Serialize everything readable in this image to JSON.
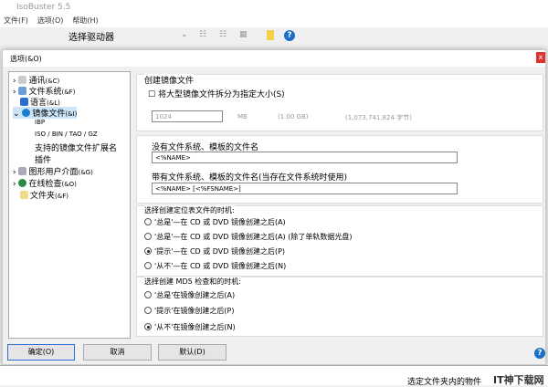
{
  "app": {
    "title": "IsoBuster 5.5",
    "menu": [
      "文件(F)",
      "选项(O)",
      "帮助(H)"
    ],
    "drive_select": "选择驱动器",
    "status": "选定文件夹内的物件",
    "watermark": "IT神下载网"
  },
  "dialog": {
    "title": "选项(&O)",
    "close": "x",
    "tree": [
      {
        "label": "通讯",
        "key": "(&C)"
      },
      {
        "label": "文件系统",
        "key": "(&F)"
      },
      {
        "label": "语言",
        "key": "(&L)"
      },
      {
        "label": "镜像文件",
        "key": "(&I)"
      },
      {
        "label": "IBP",
        "key": ""
      },
      {
        "label": "ISO / BIN / TAO / GZ",
        "key": ""
      },
      {
        "label": "支持的镜像文件扩展名",
        "key": ""
      },
      {
        "label": "插件",
        "key": ""
      },
      {
        "label": "图形用户介面",
        "key": "(&G)"
      },
      {
        "label": "在线检查",
        "key": "(&O)"
      },
      {
        "label": "文件夹",
        "key": "(&F)"
      }
    ],
    "create": {
      "title": "创建镜像文件",
      "split_label": "将大型镜像文件拆分为指定大小(S)",
      "size_value": "1024",
      "unit": "MB",
      "gb": "(1.00 GB)",
      "bytes": "(1,073,741,824 字节)"
    },
    "names": {
      "no_fs_label": "没有文件系统、模板的文件名",
      "no_fs_value": "<%NAME>",
      "fs_label": "带有文件系统、模板的文件名(当存在文件系统时使用)",
      "fs_value": "<%NAME> [<%FSNAME>]"
    },
    "cue": {
      "title": "选择创建定位表文件的时机:",
      "options": [
        "'总是'—在 CD 或 DVD 镜像创建之后(A)",
        "'总是'—在 CD 或 DVD 镜像创建之后(A) (除了单轨数据光盘)",
        "'提示'—在 CD 或 DVD 镜像创建之后(P)",
        "'从不'—在 CD 或 DVD 镜像创建之后(N)"
      ],
      "selected": 2
    },
    "md5": {
      "title": "选择创建 MD5 检查和的时机:",
      "options": [
        "'总是'在镜像创建之后(A)",
        "'提示'在镜像创建之后(P)",
        "'从不'在镜像创建之后(N)"
      ],
      "selected": 2
    },
    "buttons": {
      "ok": "确定(O)",
      "cancel": "取消",
      "default": "默认(D)",
      "help": "?"
    }
  }
}
